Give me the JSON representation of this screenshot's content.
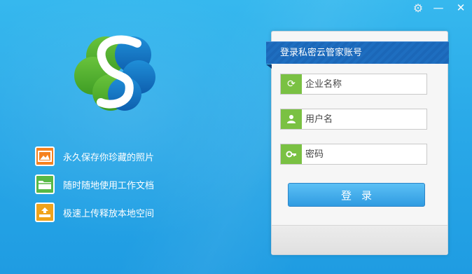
{
  "window": {
    "controls": {
      "settings_icon": "gear-icon",
      "minimize": "—",
      "close": "✕"
    }
  },
  "features": [
    {
      "label": "永久保存你珍藏的照片",
      "icon": "photo-icon",
      "color": "#f58220"
    },
    {
      "label": "随时随地使用工作文档",
      "icon": "folder-icon",
      "color": "#58b947"
    },
    {
      "label": "极速上传释放本地空间",
      "icon": "upload-icon",
      "color": "#f0a31a"
    }
  ],
  "login": {
    "title": "登录私密云管家账号",
    "enterprise": {
      "placeholder": "企业名称",
      "value": ""
    },
    "username": {
      "placeholder": "用户名",
      "value": ""
    },
    "password": {
      "placeholder": "密码",
      "value": ""
    },
    "submit_label": "登录"
  },
  "colors": {
    "background": "#2aa9e8",
    "ribbon": "#1b67b8",
    "field_icon": "#7ac143",
    "button": "#2f9be1"
  }
}
